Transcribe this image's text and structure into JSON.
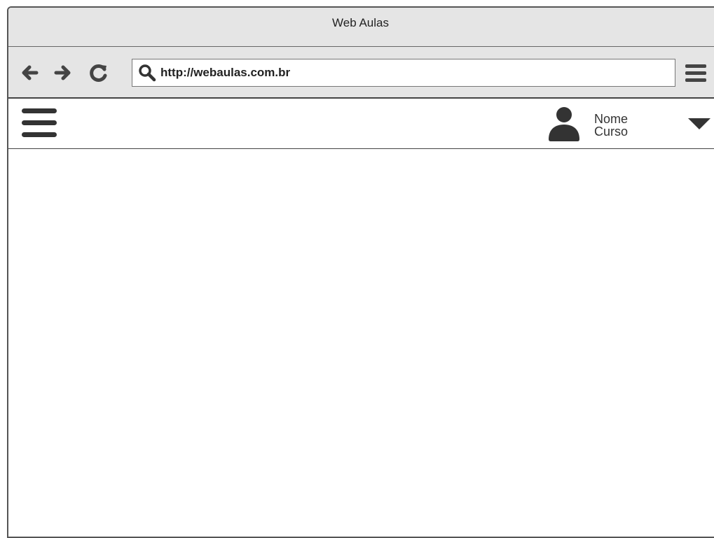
{
  "window": {
    "title": "Web Aulas"
  },
  "toolbar": {
    "back_icon": "arrow-left-icon",
    "forward_icon": "arrow-right-icon",
    "reload_icon": "reload-icon",
    "address": {
      "value": "http://webaulas.com.br",
      "search_icon": "search-icon"
    },
    "menu_icon": "browser-menu-icon"
  },
  "app_header": {
    "menu_icon": "hamburger-menu-icon",
    "user": {
      "avatar_icon": "user-icon",
      "name": "Nome",
      "course": "Curso",
      "dropdown_icon": "caret-down-icon"
    }
  },
  "colors": {
    "chrome_bg": "#e5e5e5",
    "icon": "#333333",
    "border": "#555555"
  }
}
